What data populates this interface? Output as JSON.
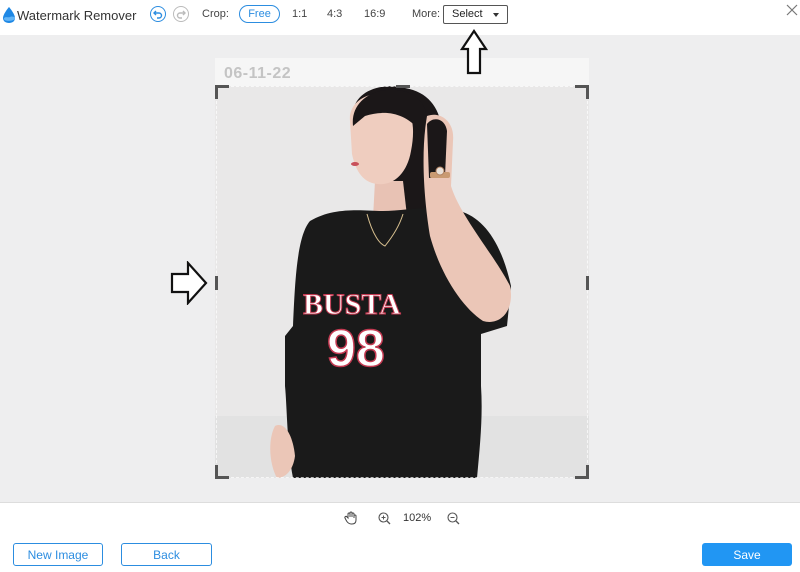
{
  "app": {
    "title": "Watermark Remover"
  },
  "toolbar": {
    "crop_label": "Crop:",
    "crop_options": [
      "Free",
      "1:1",
      "4:3",
      "16:9"
    ],
    "crop_selected": "Free",
    "more_label": "More:",
    "more_select_value": "Select"
  },
  "image": {
    "watermark_text": "06-11-22",
    "shirt_text": "BUSTA",
    "shirt_number": "98"
  },
  "zoom": {
    "level": "102%"
  },
  "footer": {
    "new_image_label": "New Image",
    "back_label": "Back",
    "save_label": "Save"
  },
  "colors": {
    "accent": "#2c8de0",
    "save_button": "#2196f3",
    "canvas_bg": "#eeeeef"
  }
}
